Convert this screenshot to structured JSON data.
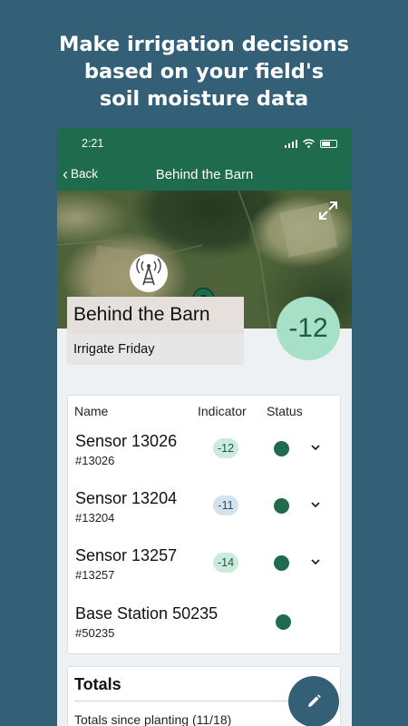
{
  "promo": {
    "line1": "Make irrigation decisions",
    "line2": "based on your field's",
    "line3": "soil moisture data"
  },
  "status_bar": {
    "time": "2:21"
  },
  "nav": {
    "back_label": "Back",
    "title": "Behind the Barn"
  },
  "map": {
    "icons": [
      "expand-icon",
      "base-station-tower-icon",
      "map-pin-icon"
    ]
  },
  "field": {
    "name": "Behind the Barn",
    "recommendation": "Irrigate Friday",
    "indicator": "-12"
  },
  "sensors": {
    "headers": {
      "name": "Name",
      "indicator": "Indicator",
      "status": "Status"
    },
    "rows": [
      {
        "name": "Sensor 13026",
        "id": "#13026",
        "indicator": "-12",
        "indicator_color": "green",
        "status_color": "#1f6b4d",
        "expandable": true
      },
      {
        "name": "Sensor 13204",
        "id": "#13204",
        "indicator": "-11",
        "indicator_color": "blue",
        "status_color": "#1f6b4d",
        "expandable": true
      },
      {
        "name": "Sensor 13257",
        "id": "#13257",
        "indicator": "-14",
        "indicator_color": "green",
        "status_color": "#1f6b4d",
        "expandable": true
      },
      {
        "name": "Base Station 50235",
        "id": "#50235",
        "indicator": "",
        "status_color": "#1f6b4d",
        "expandable": false
      }
    ]
  },
  "totals": {
    "title": "Totals",
    "subtitle": "Totals since planting (11/18)"
  },
  "fab": {
    "icon": "pencil-icon"
  },
  "colors": {
    "background": "#335f77",
    "header_green": "#1f6b4d",
    "indicator_green": "#a6e0c7"
  }
}
